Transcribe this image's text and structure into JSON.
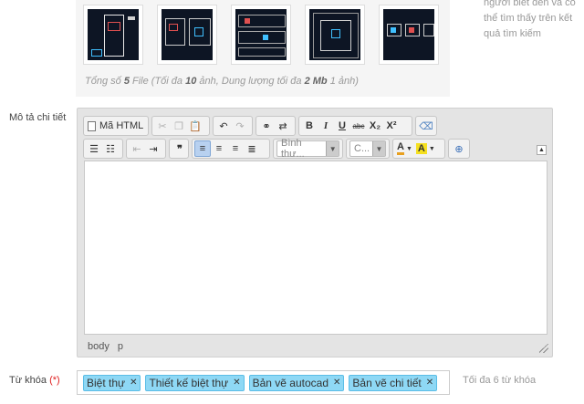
{
  "hint": {
    "text": "người biết đến và có thể tìm thấy trên kết quả tìm kiếm"
  },
  "thumbnails": [
    {
      "name": "thumbnail-1"
    },
    {
      "name": "thumbnail-2"
    },
    {
      "name": "thumbnail-3"
    },
    {
      "name": "thumbnail-4"
    },
    {
      "name": "thumbnail-5"
    }
  ],
  "file_count": {
    "prefix": "Tổng số",
    "count": "5",
    "unit": "File",
    "note_pre": "(Tối đa",
    "max_images": "10",
    "note_mid": "ảnh, Dung lượng tối đa",
    "max_size": "2 Mb",
    "note_post": "1 ảnh)"
  },
  "description": {
    "label": "Mô tả chi tiết",
    "toolbar": {
      "html_label": "Mã HTML",
      "format_select": "Bình thư...",
      "size_select": "C...",
      "bold": "B",
      "italic": "I",
      "underline": "U",
      "strike": "abc",
      "subscript": "X₂",
      "superscript": "X²",
      "quote": "❞"
    },
    "path": [
      "body",
      "p"
    ]
  },
  "keywords": {
    "label": "Từ khóa",
    "required_mark": "(*)",
    "tags": [
      "Biệt thự",
      "Thiết kế biệt thự",
      "Bản vẽ autocad",
      "Bản vẽ chi tiết"
    ],
    "limit_text": "Tối đa 6 từ khóa"
  }
}
